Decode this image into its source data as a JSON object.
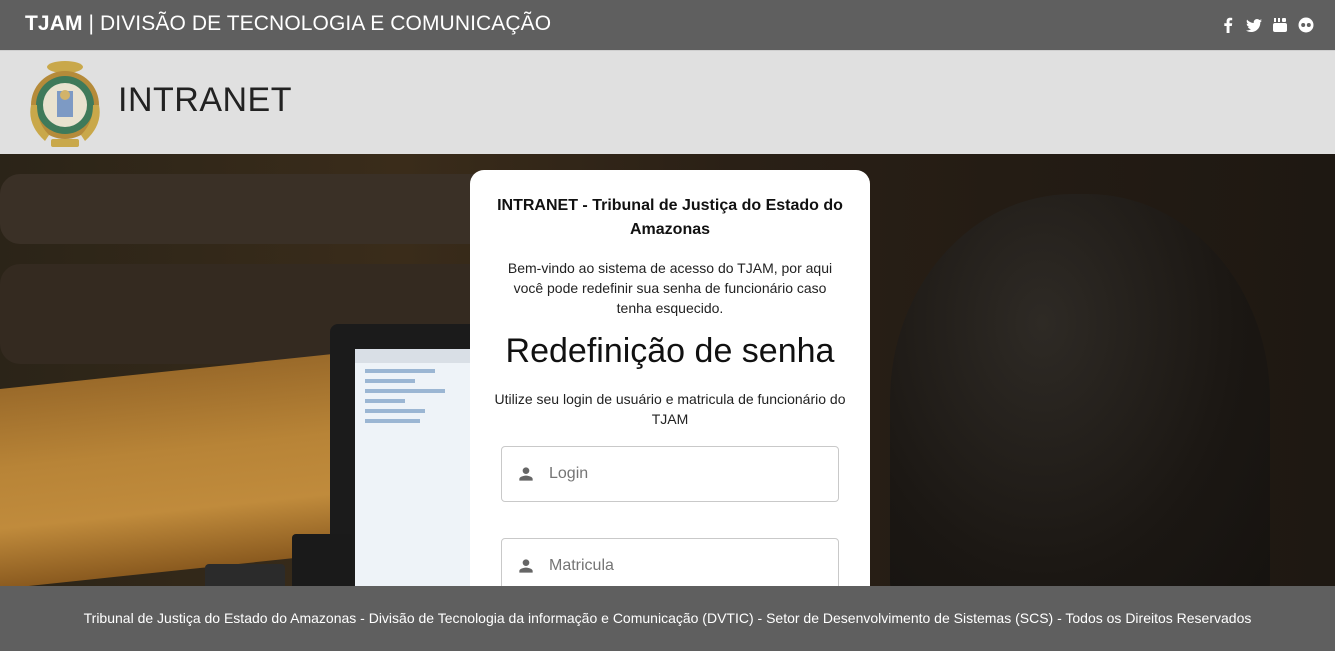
{
  "topbar": {
    "brand_bold": "TJAM",
    "brand_rest": " | DIVISÃO DE TECNOLOGIA E COMUNICAÇÃO",
    "social": [
      "facebook-icon",
      "twitter-icon",
      "youtube-icon",
      "flickr-icon"
    ]
  },
  "header": {
    "title": "INTRANET"
  },
  "card": {
    "title": "INTRANET - Tribunal de Justiça do Estado do Amazonas",
    "intro": "Bem-vindo ao sistema de acesso do TJAM, por aqui você pode redefinir sua senha de funcionário caso tenha esquecido.",
    "heading": "Redefinição de senha",
    "subtitle": "Utilize seu login de usuário e matricula de funcionário do TJAM",
    "login_placeholder": "Login",
    "matricula_placeholder": "Matricula"
  },
  "footer": {
    "text": "Tribunal de Justiça do Estado do Amazonas - Divisão de Tecnologia da informação e Comunicação (DVTIC) - Setor de Desenvolvimento de Sistemas (SCS) - Todos os Direitos Reservados"
  }
}
